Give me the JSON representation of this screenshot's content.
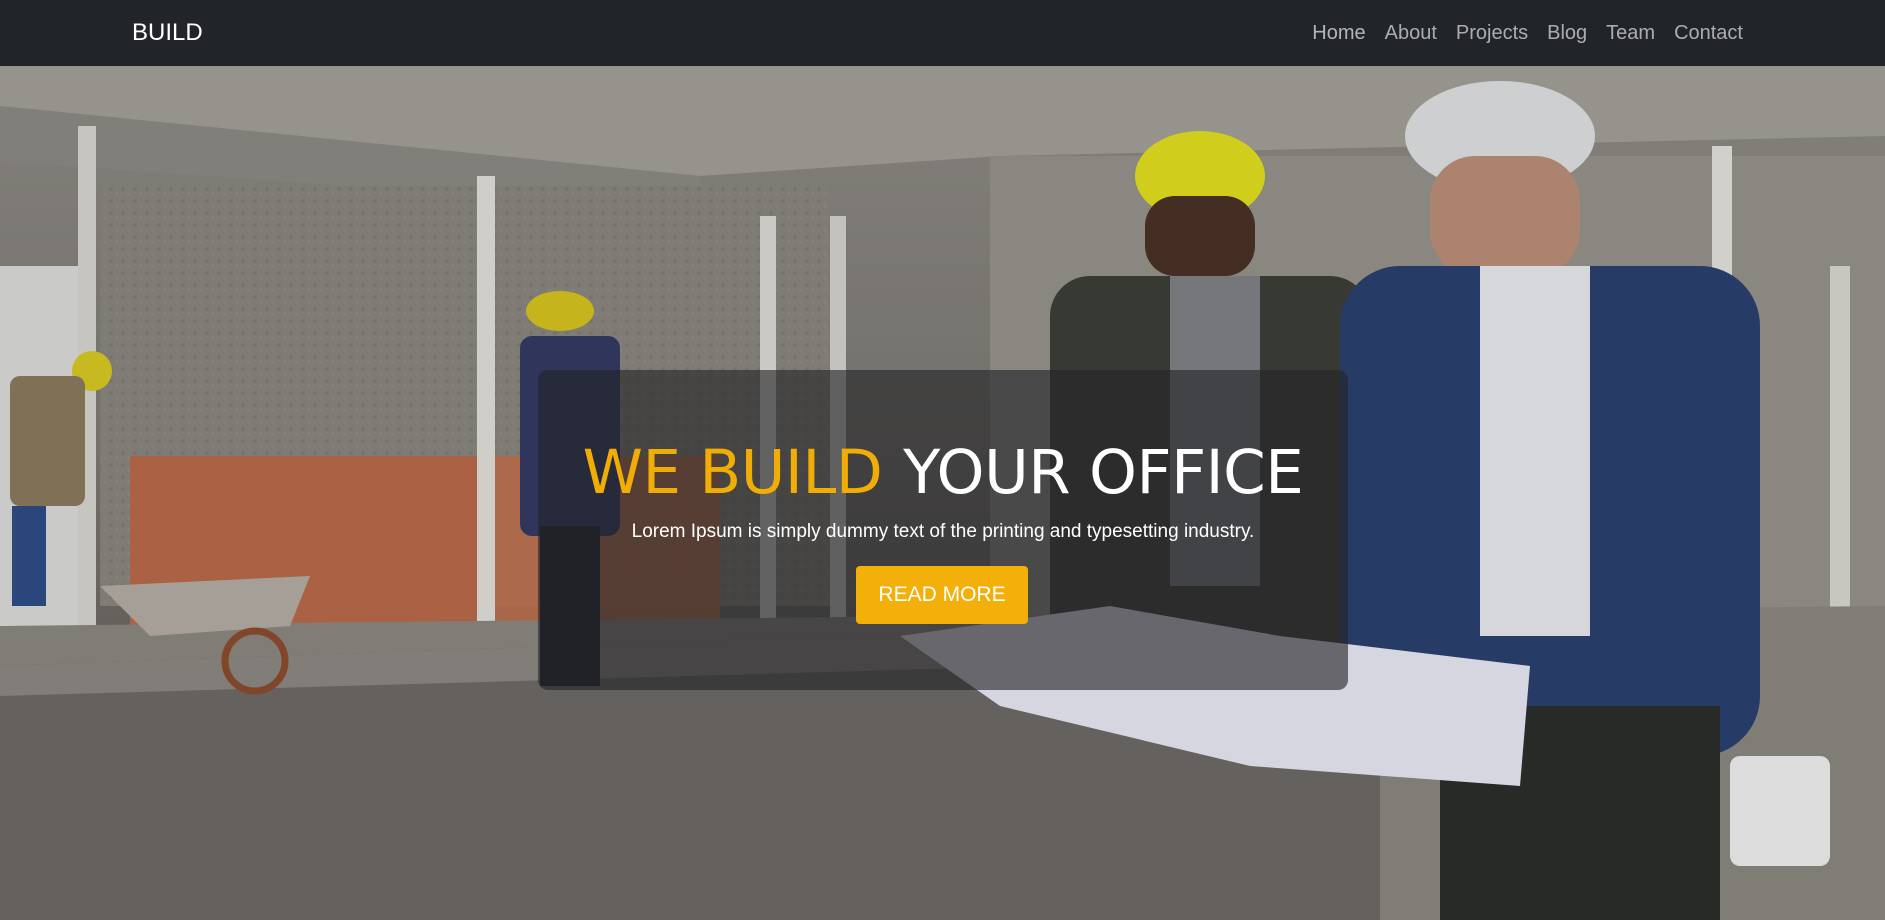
{
  "navbar": {
    "brand": "BUILD",
    "links": [
      "Home",
      "About",
      "Projects",
      "Blog",
      "Team",
      "Contact"
    ]
  },
  "hero": {
    "headline_accent": "WE BUILD",
    "headline_rest": "YOUR OFFICE",
    "subtitle": "Lorem Ipsum is simply dummy text of the printing and typesetting industry.",
    "cta_label": "READ MORE",
    "background_image": "construction-site-photo"
  },
  "colors": {
    "navbar_bg": "#212529",
    "accent": "#f3af0a",
    "caption_overlay": "rgba(35,35,38,0.62)"
  }
}
